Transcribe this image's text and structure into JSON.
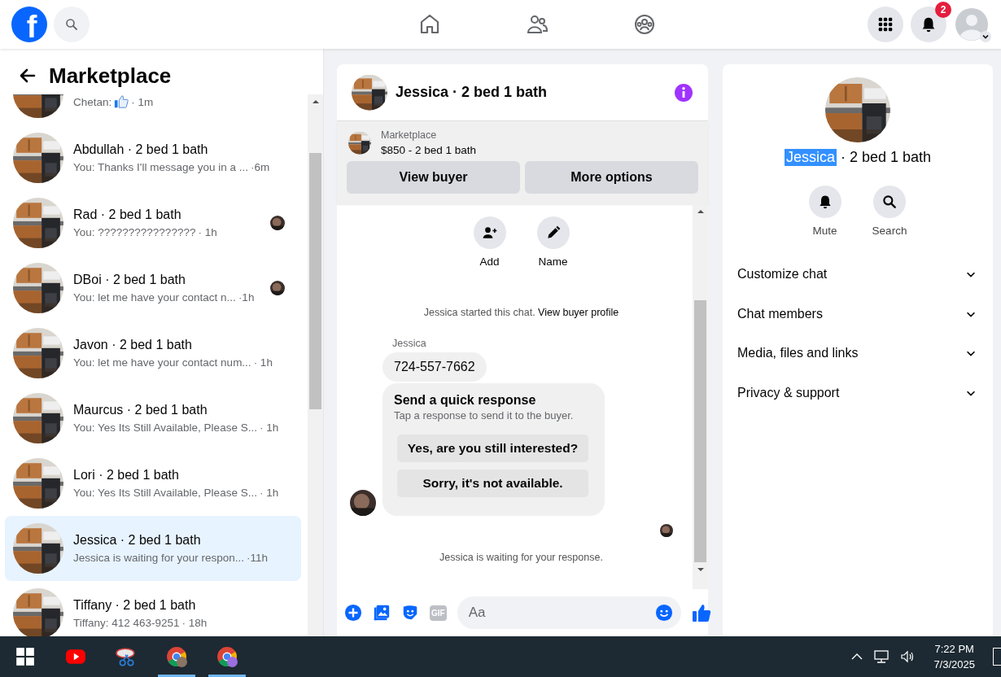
{
  "top_bar": {
    "logo": "f",
    "notification_count": "2"
  },
  "sidebar": {
    "title": "Marketplace",
    "conversations": [
      {
        "kind": "partial",
        "preview": "Chetan:",
        "preview_like": true,
        "time": "· 1m",
        "seen": false,
        "selected": false
      },
      {
        "kind": "full",
        "name": "Abdullah · 2 bed 1 bath",
        "preview": "You: Thanks I'll message you in a ...",
        "preview_like": false,
        "time": "·6m",
        "seen": false,
        "selected": false
      },
      {
        "kind": "full",
        "name": "Rad · 2 bed 1 bath",
        "preview": "You: ????????????????",
        "preview_like": false,
        "time": "· 1h",
        "seen": true,
        "selected": false
      },
      {
        "kind": "full",
        "name": "DBoi · 2 bed 1 bath",
        "preview": "You: let me have your contact n...",
        "preview_like": false,
        "time": "·1h",
        "seen": true,
        "selected": false
      },
      {
        "kind": "full",
        "name": "Javon · 2 bed 1 bath",
        "preview": "You: let me have your contact num...",
        "preview_like": false,
        "time": "· 1h",
        "seen": false,
        "selected": false
      },
      {
        "kind": "full",
        "name": "Maurcus · 2 bed 1 bath",
        "preview": "You: Yes Its Still Available, Please S...",
        "preview_like": false,
        "time": "· 1h",
        "seen": false,
        "selected": false
      },
      {
        "kind": "full",
        "name": "Lori · 2 bed 1 bath",
        "preview": "You: Yes Its Still Available, Please S...",
        "preview_like": false,
        "time": "· 1h",
        "seen": false,
        "selected": false
      },
      {
        "kind": "full",
        "name": "Jessica · 2 bed 1 bath",
        "preview": "Jessica is waiting for your respon...",
        "preview_like": false,
        "time": "·11h",
        "seen": false,
        "selected": true
      },
      {
        "kind": "full",
        "name": "Tiffany · 2 bed 1 bath",
        "preview": "Tiffany: 412 463-9251",
        "preview_like": false,
        "time": "· 18h",
        "seen": false,
        "selected": false
      }
    ]
  },
  "chat": {
    "title": "Jessica · 2 bed 1 bath",
    "listing": {
      "label": "Marketplace",
      "title": "$850 - 2 bed 1 bath",
      "buttons": [
        "View buyer",
        "More options"
      ]
    },
    "actions": [
      "Add",
      "Name"
    ],
    "started": {
      "text": "Jessica started this chat.",
      "link": "View buyer profile"
    },
    "message": {
      "sender": "Jessica",
      "text": "724-557-7662"
    },
    "quick_response": {
      "title": "Send a quick response",
      "subtitle": "Tap a response to send it to the buyer.",
      "options": [
        "Yes, are you still interested?",
        "Sorry, it's not available."
      ]
    },
    "status": "Jessica is waiting for your response.",
    "composer": {
      "gif_label": "GIF",
      "placeholder": "Aa"
    }
  },
  "details": {
    "name": "Jessica",
    "name_selected": true,
    "subtitle": "· 2 bed 1 bath",
    "actions": [
      "Mute",
      "Search"
    ],
    "sections": [
      {
        "label": "Customize chat",
        "expanded": false
      },
      {
        "label": "Chat members",
        "expanded": false
      },
      {
        "label": "Media, files and links",
        "expanded": false
      },
      {
        "label": "Privacy & support",
        "expanded": false
      }
    ]
  },
  "taskbar": {
    "apps": [
      {
        "running": false
      },
      {
        "running": false
      },
      {
        "running": false
      },
      {
        "running": true
      },
      {
        "running": true
      }
    ],
    "time": "7:22 PM",
    "date": "7/3/2025"
  }
}
